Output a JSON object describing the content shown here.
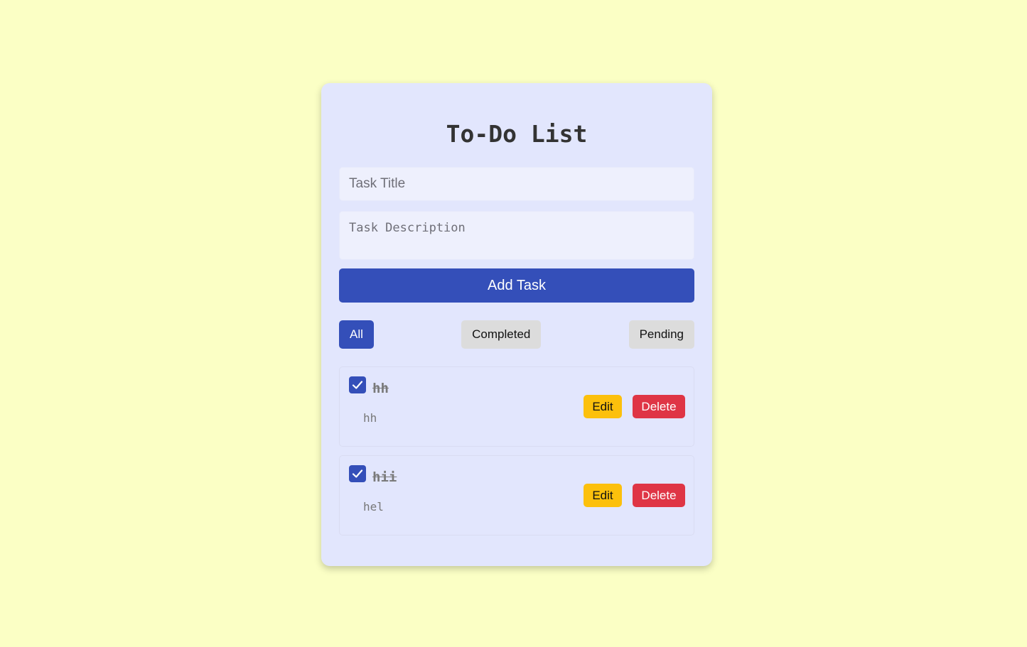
{
  "app": {
    "heading": "To-Do List"
  },
  "form": {
    "title_value": "",
    "title_placeholder": "Task Title",
    "description_value": "",
    "description_placeholder": "Task Description",
    "add_label": "Add Task"
  },
  "filters": {
    "selected": "All",
    "items": [
      {
        "label": "All",
        "active": true
      },
      {
        "label": "Completed",
        "active": false
      },
      {
        "label": "Pending",
        "active": false
      }
    ]
  },
  "tasks": [
    {
      "title": "hh",
      "description": "hh",
      "completed": true,
      "edit_label": "Edit",
      "delete_label": "Delete"
    },
    {
      "title": "hii",
      "description": "hel",
      "completed": true,
      "edit_label": "Edit",
      "delete_label": "Delete"
    }
  ],
  "icons": {
    "checkbox": "checkmark-icon"
  },
  "colors": {
    "page_background": "#fbffc5",
    "card_background": "#e2e6fd",
    "primary": "#344fb9",
    "edit": "#fcc00c",
    "delete": "#df3545",
    "filter_inactive": "#dcdcdc"
  }
}
